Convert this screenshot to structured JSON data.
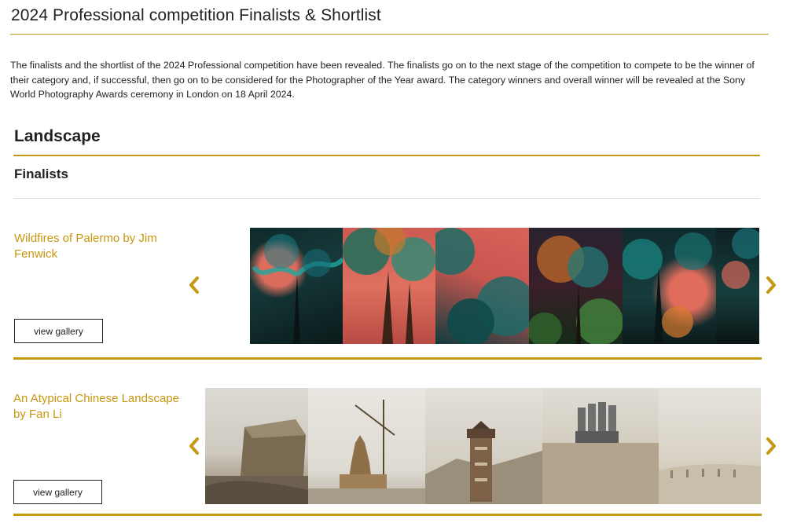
{
  "page": {
    "title": "2024 Professional competition Finalists & Shortlist",
    "intro": "The finalists and the shortlist of the 2024 Professional competition have been revealed. The finalists go on to the next stage of the competition to compete to be the winner of their category and, if successful, then go on to be considered for the Photographer of the Year award. The category winners and overall winner will be revealed at the Sony World Photography Awards ceremony in London on 18 April 2024."
  },
  "section": {
    "title": "Landscape",
    "subsection": "Finalists"
  },
  "entries": [
    {
      "title": "Wildfires of Palermo by Jim Fenwick",
      "button": "view gallery",
      "image_count": 6
    },
    {
      "title": "An Atypical Chinese Landscape by Fan Li",
      "button": "view gallery",
      "image_count": 5
    }
  ],
  "icons": {
    "prev": "chevron-left-icon",
    "next": "chevron-right-icon"
  },
  "colors": {
    "accent": "#c49a12",
    "entry_title": "#c8960c"
  }
}
